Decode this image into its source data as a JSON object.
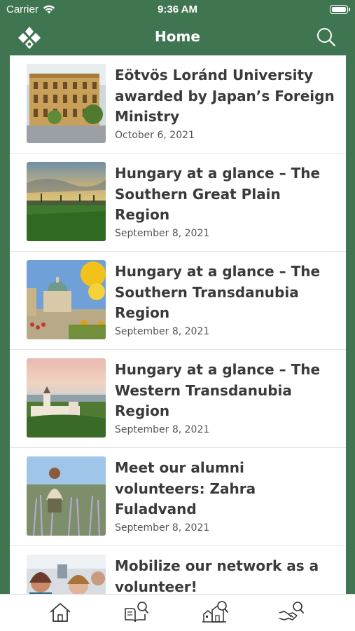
{
  "status_bar": {
    "carrier": "Carrier",
    "time": "9:36 AM"
  },
  "nav": {
    "title": "Home",
    "logo_icon": "diamond-logo-icon",
    "search_icon": "search-icon"
  },
  "articles": [
    {
      "title": "Eötvös Loránd University awarded by Japan’s Foreign Ministry",
      "date": "October 6, 2021"
    },
    {
      "title": "Hungary at a glance – The Southern Great Plain Region",
      "date": "September 8, 2021"
    },
    {
      "title": "Hungary at a glance – The Southern Transdanubia Region",
      "date": "September 8, 2021"
    },
    {
      "title": "Hungary at a glance – The Western Transdanubia Region",
      "date": "September 8, 2021"
    },
    {
      "title": "Meet our alumni volunteers: Zahra Fuladvand",
      "date": "September 8, 2021"
    },
    {
      "title": "Mobilize our network as a volunteer!",
      "date": ""
    }
  ],
  "tab_bar": {
    "icons": [
      "home-icon",
      "book-search-icon",
      "buildings-search-icon",
      "handshake-search-icon"
    ]
  },
  "colors": {
    "brand_green": "#3f7550",
    "title_text": "#3a3a3a"
  }
}
